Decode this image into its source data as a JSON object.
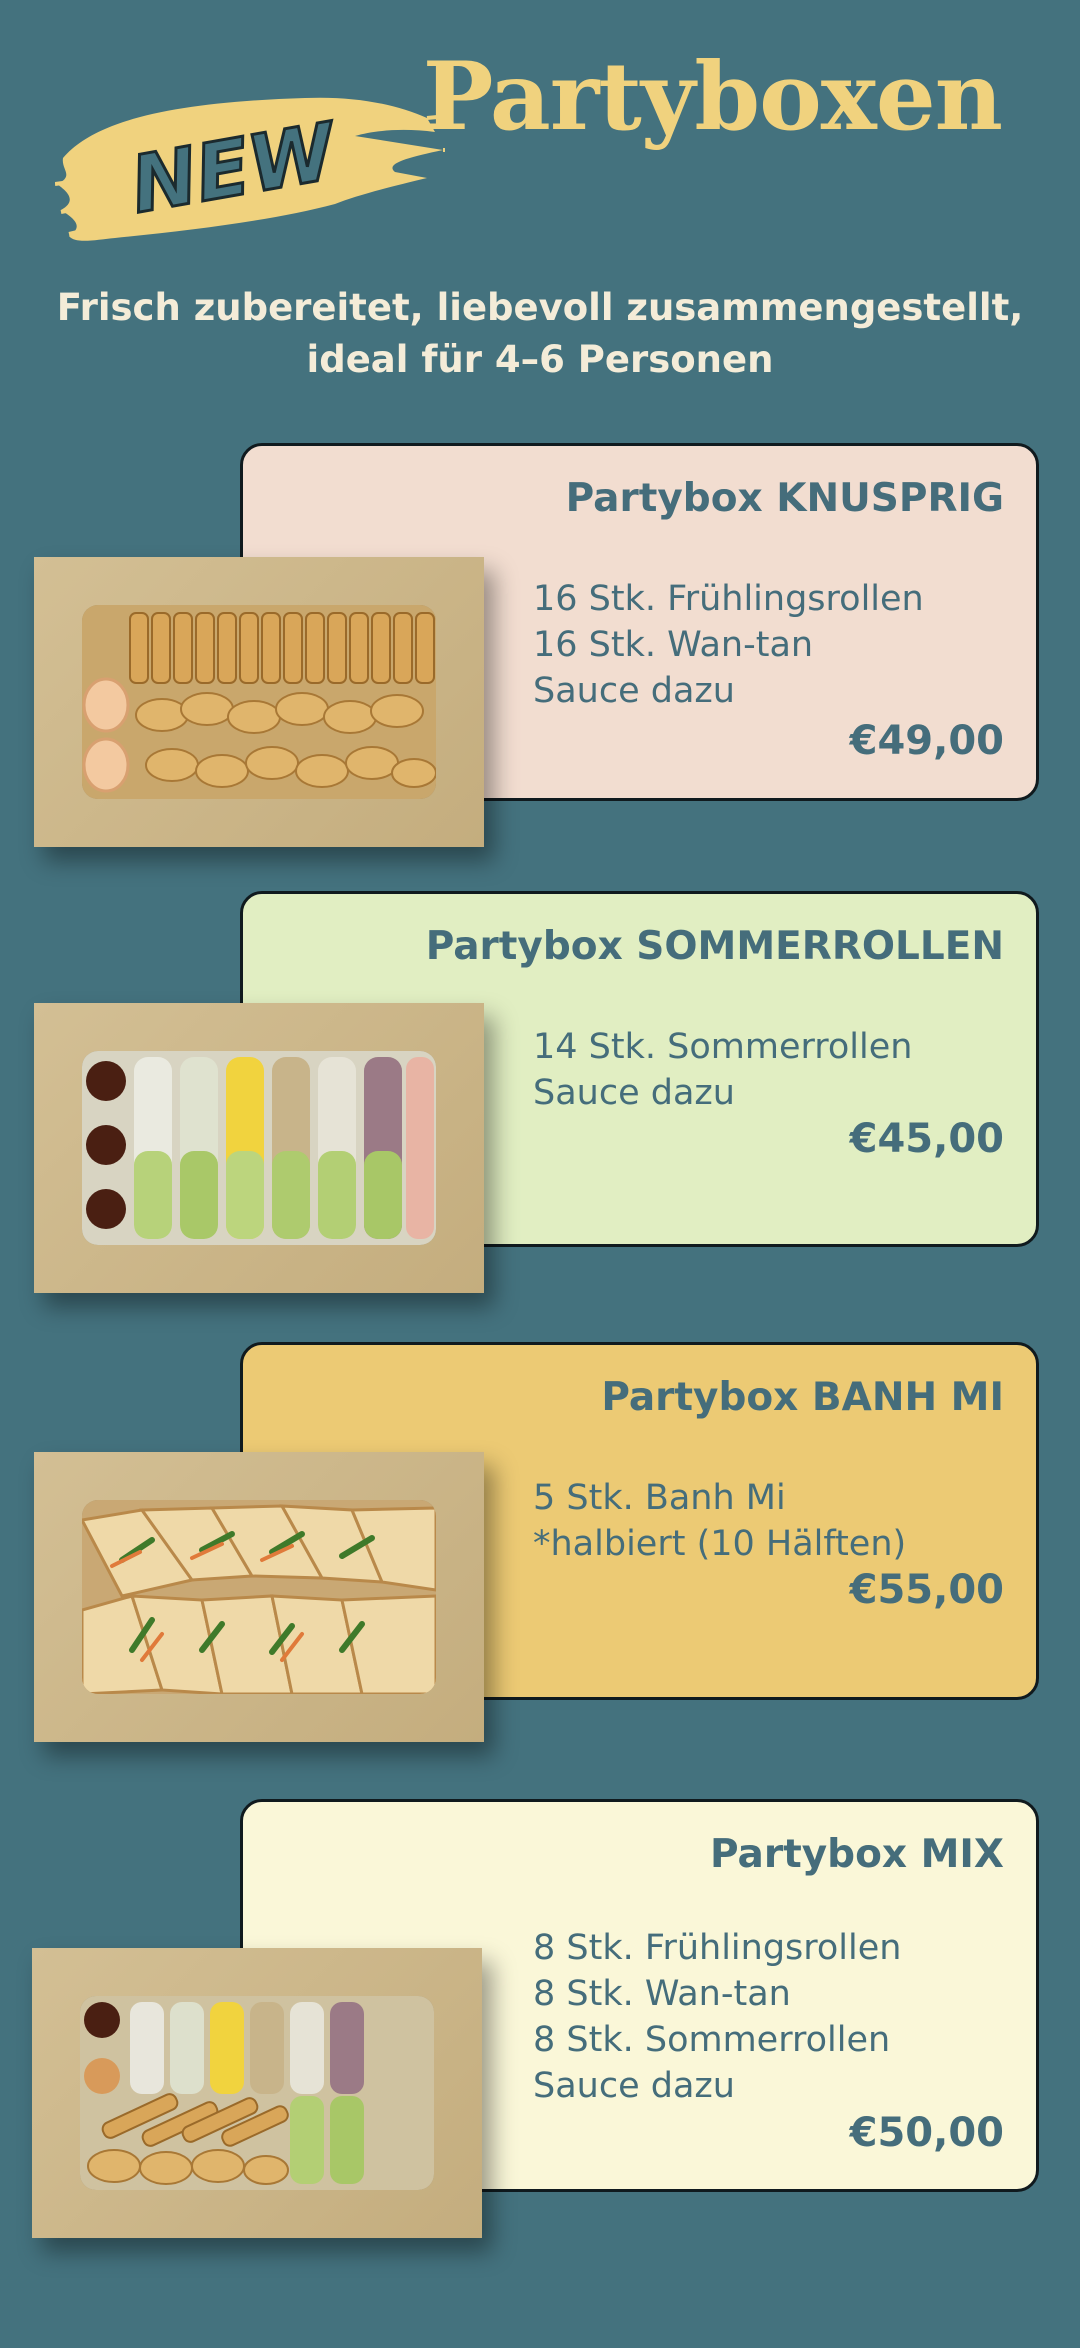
{
  "badge": {
    "text": "NEW"
  },
  "header": {
    "title": "Partyboxen",
    "subtitle_line1": "Frisch zubereitet, liebevoll zusammengestellt,",
    "subtitle_line2": "ideal für 4–6 Personen"
  },
  "colors": {
    "background": "#44727e",
    "accent_yellow": "#f0d27e",
    "text_teal": "#456d7b",
    "card_knusprig": "#f2ddd0",
    "card_sommerrollen": "#e1eec2",
    "card_banhmi": "#ecca74",
    "card_mix": "#faf7d8"
  },
  "boxes": [
    {
      "title": "Partybox KNUSPRIG",
      "items": [
        "16 Stk. Frühlingsrollen",
        "16 Stk. Wan-tan",
        "Sauce dazu"
      ],
      "price": "€49,00",
      "image": "box-knusprig-image"
    },
    {
      "title": "Partybox SOMMERROLLEN",
      "items": [
        "14 Stk. Sommerrollen",
        "Sauce dazu"
      ],
      "price": "€45,00",
      "image": "box-sommerrollen-image"
    },
    {
      "title": "Partybox BANH MI",
      "items": [
        "5 Stk. Banh Mi",
        "*halbiert (10 Hälften)"
      ],
      "price": "€55,00",
      "image": "box-banhmi-image"
    },
    {
      "title": "Partybox MIX",
      "items": [
        "8 Stk. Frühlingsrollen",
        "8 Stk. Wan-tan",
        "8 Stk. Sommerrollen",
        "Sauce dazu"
      ],
      "price": "€50,00",
      "image": "box-mix-image"
    }
  ]
}
